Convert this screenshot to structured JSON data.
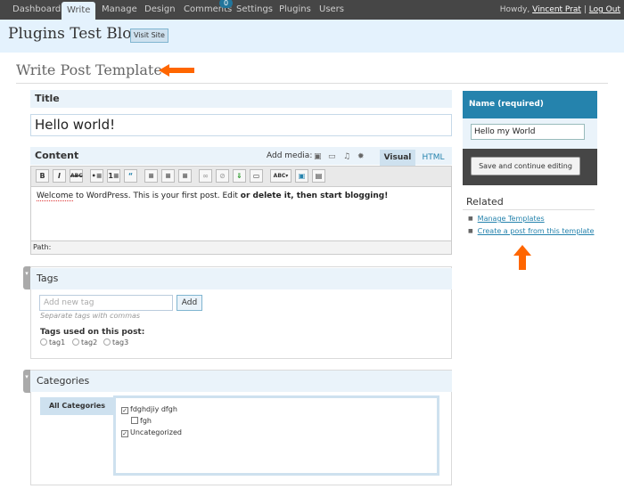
{
  "nav": {
    "items": [
      {
        "label": "Dashboard"
      },
      {
        "label": "Write"
      },
      {
        "label": "Manage"
      },
      {
        "label": "Design"
      },
      {
        "label": "Comments"
      },
      {
        "label": "Settings"
      },
      {
        "label": "Plugins"
      },
      {
        "label": "Users"
      }
    ],
    "comments_badge": "0",
    "howdy": "Howdy,",
    "user": "Vincent Prat",
    "separator": "|",
    "logout": "Log Out"
  },
  "header": {
    "blog_title": "Plugins Test Blog",
    "visit_site": "Visit Site"
  },
  "page": {
    "title": "Write Post Template"
  },
  "title_box": {
    "heading": "Title",
    "value": "Hello world!"
  },
  "content_box": {
    "heading": "Content",
    "add_media": "Add media:",
    "tab_visual": "Visual",
    "tab_html": "HTML",
    "text_part1": "Welcome",
    "text_part2": " to WordPress. This is your first post. Edit ",
    "text_part3": "or delete it, then start blogging!",
    "path": "Path:",
    "toolbar": [
      "B",
      "I",
      "ABC",
      "•≡",
      "1≡",
      "“",
      "≡",
      "≡",
      "≡",
      "∞",
      "⊘",
      "⇓",
      "▭",
      "ABC▾",
      "▣",
      "▤"
    ]
  },
  "tags_box": {
    "heading": "Tags",
    "placeholder": "Add new tag",
    "add_button": "Add",
    "hint": "Separate tags with commas",
    "used_label": "Tags used on this post:",
    "tags": [
      "tag1",
      "tag2",
      "tag3"
    ]
  },
  "categories_box": {
    "heading": "Categories",
    "tab": "All Categories",
    "items": [
      {
        "label": "fdghdjiy dfgh",
        "checked": true
      },
      {
        "label": "fgh",
        "checked": false
      },
      {
        "label": "Uncategorized",
        "checked": true
      }
    ]
  },
  "name_box": {
    "heading": "Name (required)",
    "value": "Hello my World",
    "save_button": "Save and continue editing"
  },
  "related": {
    "heading": "Related",
    "links": [
      "Manage Templates",
      "Create a post from this template"
    ]
  },
  "colors": {
    "nav_bg": "#464646",
    "header_bg": "#e4f2fd",
    "accent": "#2583ad",
    "annotation_arrow": "#ff6600"
  },
  "icons": [
    "arrow-left-annotation-icon",
    "arrow-up-annotation-icon",
    "image-icon",
    "video-icon",
    "music-icon",
    "media-icon",
    "grip-icon",
    "checkbox-icon"
  ]
}
